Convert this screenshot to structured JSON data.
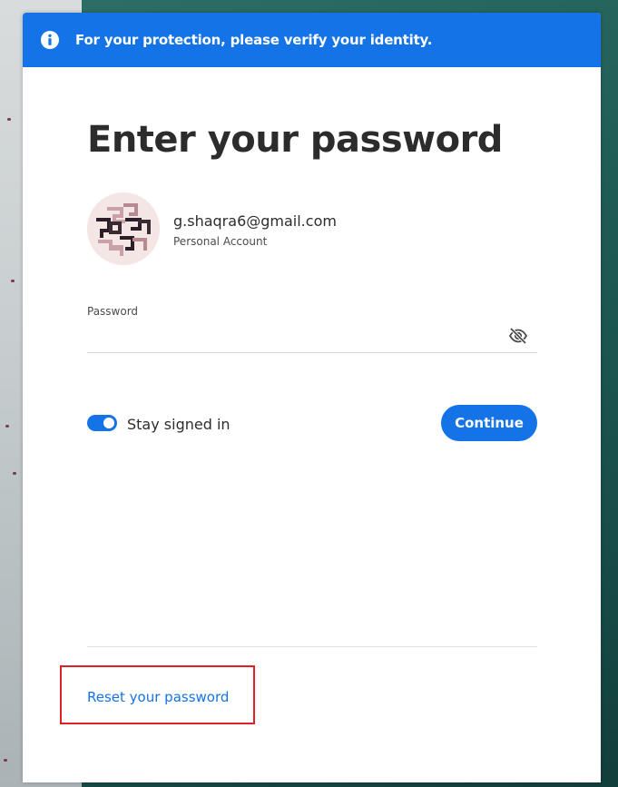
{
  "banner": {
    "text": "For your protection, please verify your identity.",
    "icon": "info-icon",
    "color": "#1473e6"
  },
  "heading": "Enter your password",
  "account": {
    "email": "g.shaqra6@gmail.com",
    "type": "Personal Account",
    "avatar_icon": "avatar"
  },
  "password": {
    "label": "Password",
    "value": "",
    "visibility_icon": "eye-slash-icon"
  },
  "stay_signed_in": {
    "label": "Stay signed in",
    "checked": true
  },
  "continue_label": "Continue",
  "reset_link": "Reset your password",
  "colors": {
    "accent": "#1473e6",
    "highlight": "#e01f27",
    "text": "#2c2c2c"
  }
}
